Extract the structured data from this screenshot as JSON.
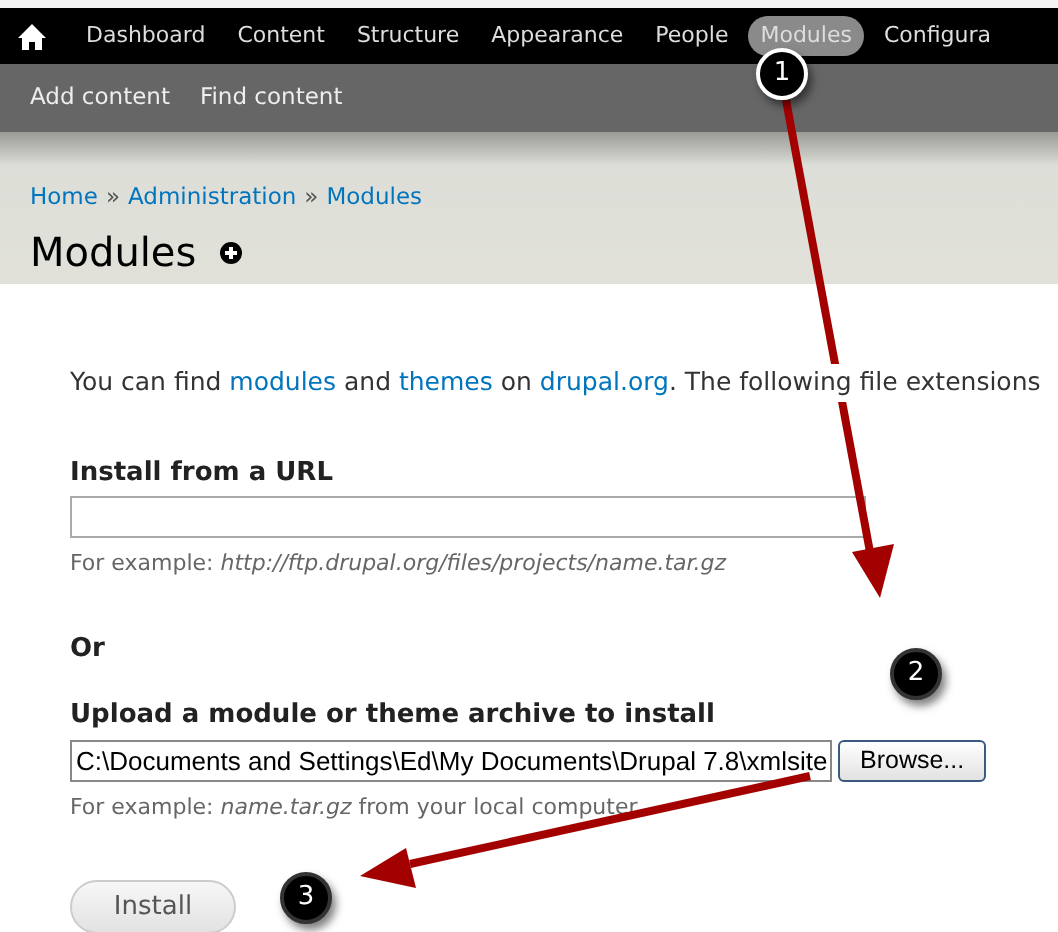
{
  "toolbar": {
    "items": [
      {
        "label": "Dashboard",
        "selected": false
      },
      {
        "label": "Content",
        "selected": false
      },
      {
        "label": "Structure",
        "selected": false
      },
      {
        "label": "Appearance",
        "selected": false
      },
      {
        "label": "People",
        "selected": false
      },
      {
        "label": "Modules",
        "selected": true
      },
      {
        "label": "Configura",
        "selected": false
      }
    ]
  },
  "shortcuts": [
    "Add content",
    "Find content"
  ],
  "breadcrumb": [
    "Home",
    "Administration",
    "Modules"
  ],
  "breadcrumb_separator": "»",
  "page_title": "Modules",
  "intro_links": [
    "modules",
    "themes",
    "drupal.org"
  ],
  "intro_parts": [
    "You can find ",
    "and",
    "on",
    ". The following file extensions"
  ],
  "url_section": {
    "label": "Install from a URL",
    "hint_prefix": "For example: ",
    "hint_example": "http://ftp.drupal.org/files/projects/name.tar.gz"
  },
  "or_label": "Or",
  "upload_section": {
    "label": "Upload a module or theme archive to install",
    "value": "C:\\Documents and Settings\\Ed\\My Documents\\Drupal 7.8\\xmlsite",
    "browse_button": "Browse...",
    "hint_prefix": "For example: ",
    "hint_example": "name.tar.gz",
    "hint_suffix": " from your local computer"
  },
  "install_button": "Install",
  "callouts": [
    {
      "label": "1"
    },
    {
      "label": "2"
    },
    {
      "label": "3"
    }
  ]
}
